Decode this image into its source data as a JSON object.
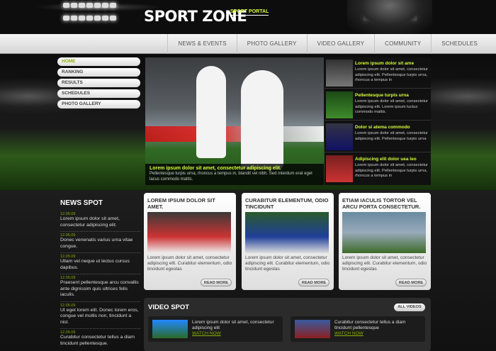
{
  "brand": {
    "name": "SPORT ZONE",
    "tagline": "SPORT PORTAL"
  },
  "nav": {
    "items": [
      "NEWS & EVENTS",
      "PHOTO GALLERY",
      "VIDEO GALLERY",
      "COMMUNITY",
      "SCHEDULES"
    ]
  },
  "side_menu": {
    "items": [
      "HOME",
      "RANKING",
      "RESULTS",
      "SCHEDULES",
      "PHOTO GALLERY"
    ],
    "active": "HOME"
  },
  "feature": {
    "title": "Lorem ipsum dolor sit amet, consectetur adipiscing elit.",
    "text": "Pellentesque turpis urna, rhoncus a tempus in, blandit vel nibh. Sed interdum erat eget lacus commodo mattis."
  },
  "thumbs": [
    {
      "title": "Lorem ipsum dolor sit ame",
      "text": "Lorem ipsum dolor sit amet, consectetur adipiscing elit. Pellentesque turpis urna, rhoncus a tempus in"
    },
    {
      "title": "Pellentesque turpis urna",
      "text": "Lorem ipsum dolor sit amet, consectetur adipiscing elit. Lorem ipsum luctus commodo mattis."
    },
    {
      "title": "Dolor si atema commodo",
      "text": "Lorem ipsum dolor sit amet, consectetur adipiscing elit. Pellentesque turpis urna"
    },
    {
      "title": "Adipiscing elit dolor uea leo",
      "text": "Lorem ipsum dolor sit amet, consectetur adipiscing elit. Pellentesque turpis urna, rhoncus a tempus in"
    }
  ],
  "news": {
    "title": "NEWS SPOT",
    "items": [
      {
        "date": "12.05.09",
        "text": "Lorem ipsum dolor sit amet, consectetur adipiscing elit."
      },
      {
        "date": "12.05.09",
        "text": "Donec venenatis varius urna vitae congue."
      },
      {
        "date": "12.05.09",
        "text": "Ullam vel neque ut lectus cursus dapibus."
      },
      {
        "date": "12.05.09",
        "text": "Praesent pellentesque arcu convallis ante dignissim quis ultrices felis iaculis."
      },
      {
        "date": "12.05.09",
        "text": "Ut eget lorem elit. Donec lorem eros, congue vel mollis non, tincidunt a nisl."
      },
      {
        "date": "12.05.09",
        "text": "Curabitur consectetur tellus a diam tincidunt pellentesque."
      }
    ]
  },
  "cards": [
    {
      "title": "LOREM IPSUM DOLOR SIT AMET.",
      "text": "Lorem ipsum dolor sit amet, consectetur adipiscing elit. Curabitur elementum, odio tincidunt egestas",
      "more": "READ MORE"
    },
    {
      "title": "CURABITUR ELEMENTUM, ODIO TINCIDUNT",
      "text": "Lorem ipsum dolor sit amet, consectetur adipiscing elit. Curabitur elementum, odio tincidunt egestas",
      "more": "READ MORE"
    },
    {
      "title": "ETIAM IACULIS TORTOR VEL ARCU PORTA CONSECTETUR.",
      "text": "Lorem ipsum dolor sit amet, consectetur adipiscing elit. Curabitur elementum, odio tincidunt egestas",
      "more": "READ MORE"
    }
  ],
  "video_spot": {
    "title": "VIDEO SPOT",
    "all_label": "ALL VIDEOS",
    "items": [
      {
        "text": "Lorem ipsum dolor sit amet, consectetur adipiscing elit",
        "watch": "WATCH NOW"
      },
      {
        "text": "Curabitur consectetur tellus a diam tincidunt pellentesque",
        "watch": "WATCH NOW"
      }
    ]
  }
}
